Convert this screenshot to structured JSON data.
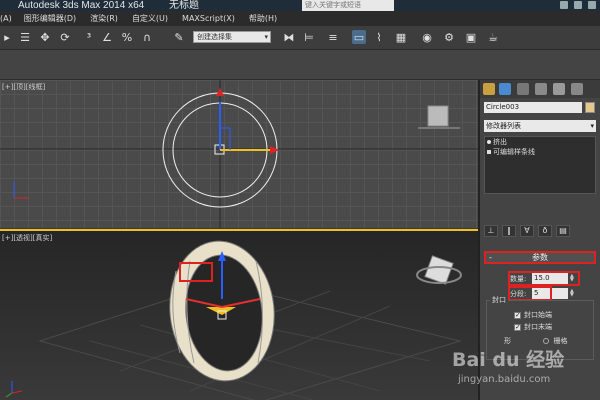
{
  "app": {
    "title": "Autodesk 3ds Max  2014 x64",
    "doc_title": "无标题",
    "search_placeholder": "键入关键字或短语"
  },
  "menu": [
    "(A)",
    "图形编辑器(D)",
    "渲染(R)",
    "自定义(U)",
    "MAXScript(X)",
    "帮助(H)"
  ],
  "toolbar": {
    "selection_set": "创建选择集",
    "icons": [
      "undo-icon",
      "redo-icon",
      "link-icon",
      "unlink-icon",
      "bind-space-warp-icon",
      "select-filter-icon",
      "select-object-icon",
      "select-by-name-icon",
      "move-icon",
      "rotate-icon",
      "scale-icon",
      "snap-3d-icon",
      "angle-snap-icon",
      "percent-snap-icon",
      "spinner-snap-icon",
      "edit-named-selection-icon",
      "mirror-icon",
      "align-icon",
      "layer-manager-icon",
      "graphite-toggle-icon",
      "curve-editor-icon",
      "schematic-view-icon",
      "material-editor-icon",
      "render-setup-icon",
      "rendered-frame-icon",
      "render-production-icon"
    ]
  },
  "viewports": {
    "top_label": "[+][顶][线框]",
    "persp_label": "[+][透视][真实]"
  },
  "command_panel": {
    "object_name": "Circle003",
    "object_color": "#e6c98a",
    "modifier_list": "修改器列表",
    "stack": [
      "挤出",
      "可编辑样条线"
    ],
    "rollout_title": "参数",
    "amount_label": "数量:",
    "amount_value": "15.0",
    "segments_label": "分段:",
    "segments_value": "5",
    "capping_label": "封口",
    "cap_start": "封口始端",
    "cap_end": "封口末端",
    "morph_label": "形",
    "grid_label": "栅格"
  },
  "watermark": {
    "main": "Bai du 经验",
    "sub": "jingyan.baidu.com"
  },
  "colors": {
    "highlight_red": "#dd2222",
    "active_viewport": "#f0c020",
    "gizmo_x": "#e23030",
    "gizmo_y": "#f0c020",
    "gizmo_z": "#2a5cff"
  }
}
